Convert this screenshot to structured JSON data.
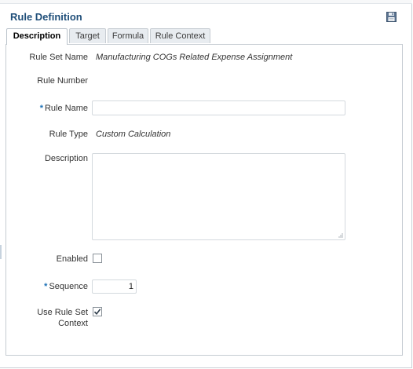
{
  "panel": {
    "title": "Rule Definition"
  },
  "tabs": [
    {
      "label": "Description",
      "active": true
    },
    {
      "label": "Target",
      "active": false
    },
    {
      "label": "Formula",
      "active": false
    },
    {
      "label": "Rule Context",
      "active": false
    }
  ],
  "form": {
    "rule_set_name": {
      "label": "Rule Set Name",
      "value": "Manufacturing COGs Related Expense Assignment"
    },
    "rule_number": {
      "label": "Rule Number",
      "value": ""
    },
    "rule_name": {
      "label": "Rule Name",
      "required_mark": "*",
      "value": ""
    },
    "rule_type": {
      "label": "Rule Type",
      "value": "Custom Calculation"
    },
    "description": {
      "label": "Description",
      "value": ""
    },
    "enabled": {
      "label": "Enabled",
      "checked": false
    },
    "sequence": {
      "label": "Sequence",
      "required_mark": "*",
      "value": "1"
    },
    "use_rule_set_context": {
      "label_line1": "Use Rule Set",
      "label_line2": "Context",
      "checked": true
    }
  },
  "colors": {
    "title": "#1f4e79",
    "required": "#1a6fb5",
    "tab_bg": "#e8ecf0"
  },
  "icons": {
    "save": "save-floppy-icon",
    "resize": "resize-grip-icon",
    "check": "check-icon"
  }
}
